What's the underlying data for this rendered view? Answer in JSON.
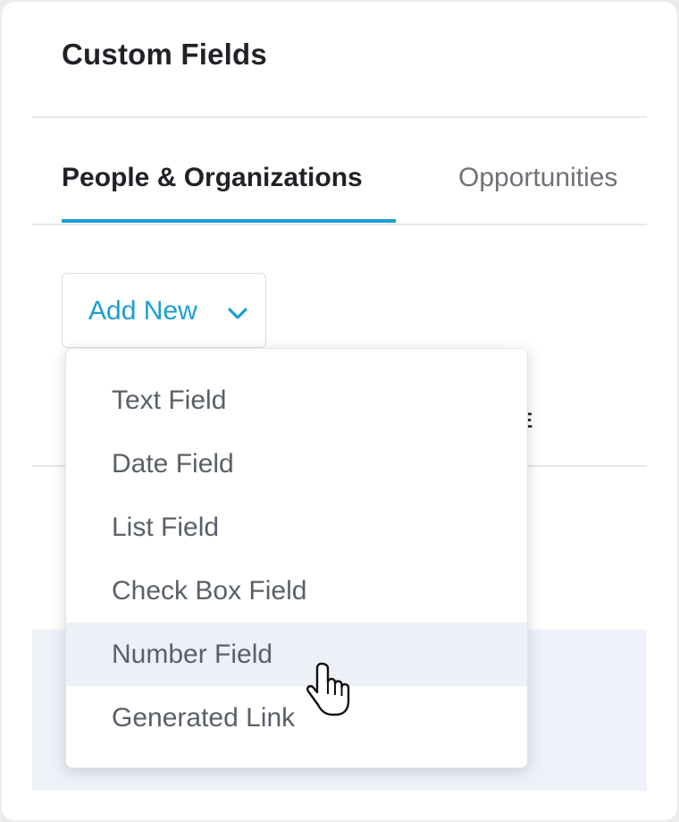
{
  "page": {
    "title": "Custom Fields"
  },
  "tabs": [
    {
      "label": "People & Organizations",
      "active": true
    },
    {
      "label": "Opportunities",
      "active": false
    }
  ],
  "add_new": {
    "label": "Add New",
    "icon": "chevron-down-icon"
  },
  "table": {
    "header_partial": "CE"
  },
  "dropdown": {
    "items": [
      {
        "label": "Text Field"
      },
      {
        "label": "Date Field"
      },
      {
        "label": "List Field"
      },
      {
        "label": "Check Box Field"
      },
      {
        "label": "Number Field",
        "hovered": true
      },
      {
        "label": "Generated Link"
      }
    ]
  },
  "colors": {
    "accent": "#1a9fd4",
    "title": "#1f2226",
    "muted": "#6d7278",
    "hover": "#edf1f7"
  },
  "cursor": {
    "icon": "hand-pointer-icon"
  }
}
